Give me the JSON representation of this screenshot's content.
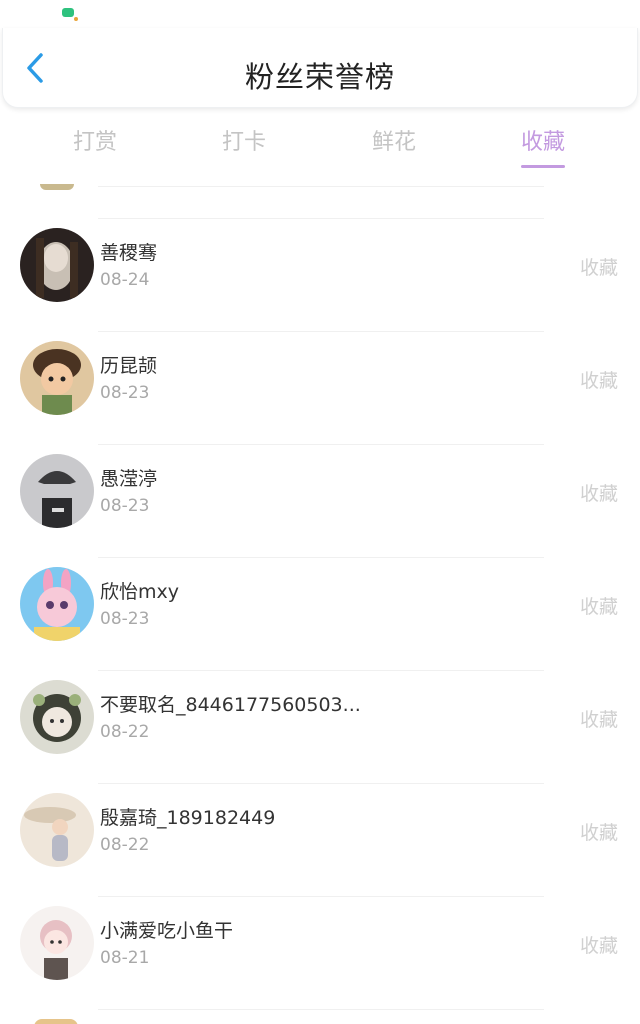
{
  "header": {
    "title": "粉丝荣誉榜"
  },
  "tabs": [
    {
      "label": "打赏"
    },
    {
      "label": "打卡"
    },
    {
      "label": "鲜花"
    },
    {
      "label": "收藏"
    }
  ],
  "active_tab": "收藏",
  "colors": {
    "accent": "#c39ae0",
    "back_arrow": "#2b9be6",
    "muted_text": "#a8a8a8",
    "action_text": "#d0d0d0"
  },
  "entries": [
    {
      "name": "善稷骞",
      "date": "08-24",
      "action": "收藏"
    },
    {
      "name": "历昆颉",
      "date": "08-23",
      "action": "收藏"
    },
    {
      "name": "愚滢渟",
      "date": "08-23",
      "action": "收藏"
    },
    {
      "name": "欣怡mxy",
      "date": "08-23",
      "action": "收藏"
    },
    {
      "name": "不要取名_8446177560503...",
      "date": "08-22",
      "action": "收藏"
    },
    {
      "name": "殷嘉琦_189182449",
      "date": "08-22",
      "action": "收藏"
    },
    {
      "name": "小满爱吃小鱼干",
      "date": "08-21",
      "action": "收藏"
    }
  ]
}
